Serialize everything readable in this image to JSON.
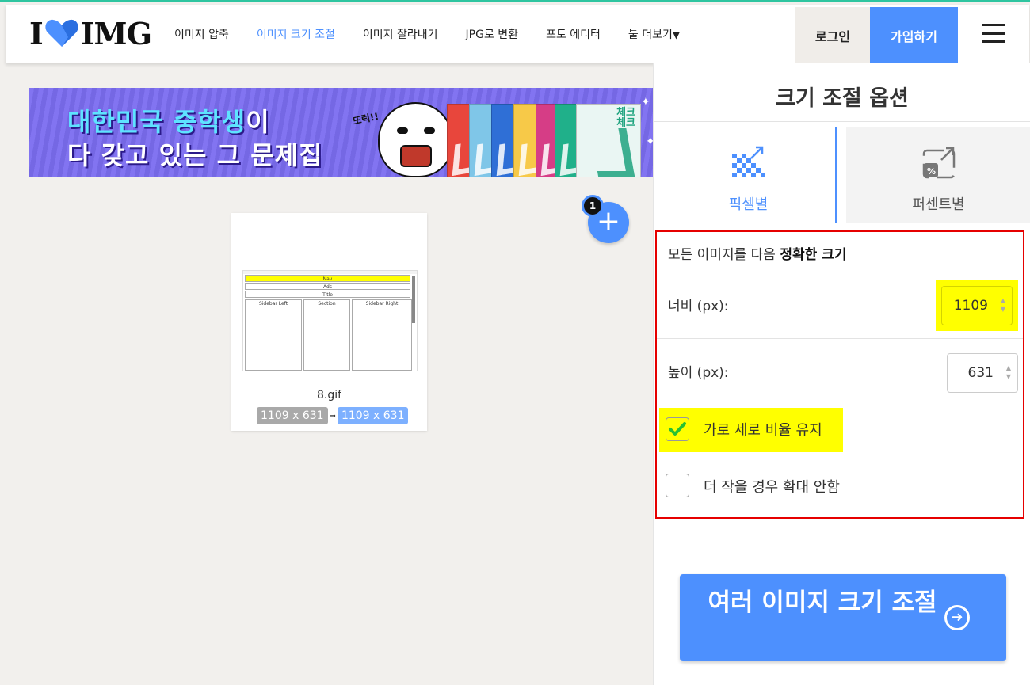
{
  "header": {
    "logo_left": "I",
    "logo_right": "IMG",
    "nav": [
      {
        "label": "이미지 압축",
        "active": false
      },
      {
        "label": "이미지 크기 조절",
        "active": true
      },
      {
        "label": "이미지 잘라내기",
        "active": false
      },
      {
        "label": "JPG로 변환",
        "active": false
      },
      {
        "label": "포토 에디터",
        "active": false
      },
      {
        "label": "툴 더보기",
        "active": false
      }
    ],
    "more_caret": "▼",
    "login": "로그인",
    "signup": "가입하기"
  },
  "ad": {
    "line1_colored": "대한민국 중학생",
    "line1_end": "이",
    "line2": "다 갖고 있는 그 문제집",
    "shout": "또럭!!",
    "book_title": "체크\n체크"
  },
  "upload": {
    "count": "1",
    "add_symbol": "+"
  },
  "file": {
    "name": "8.gif",
    "original_size": "1109 x 631",
    "new_size": "1109 x 631",
    "thumb_rows": [
      "Nav",
      "Ads",
      "Title"
    ],
    "thumb_cols": [
      "Sidebar Left",
      "Section",
      "Sidebar Right"
    ]
  },
  "panel": {
    "title": "크기 조절 옵션",
    "tabs": [
      {
        "label": "픽셀별",
        "active": true
      },
      {
        "label": "퍼센트별",
        "active": false
      }
    ],
    "header_prefix": "모든 이미지를 다음 ",
    "header_bold": "정확한 크기",
    "width_label": "너비 (px):",
    "width_value": "1109",
    "height_label": "높이 (px):",
    "height_value": "631",
    "keep_ratio_label": "가로 세로 비율 유지",
    "keep_ratio_checked": true,
    "no_enlarge_label": "더 작을 경우 확대 안함",
    "no_enlarge_checked": false,
    "submit_label": "여러 이미지 크기 조절",
    "submit_icon": "arrow-right-circle-icon"
  },
  "colors": {
    "accent": "#4d90fe",
    "teal_top": "#2fc5a0",
    "highlight": "#ffff00",
    "red_box": "#e60000",
    "check_green": "#27c132"
  }
}
